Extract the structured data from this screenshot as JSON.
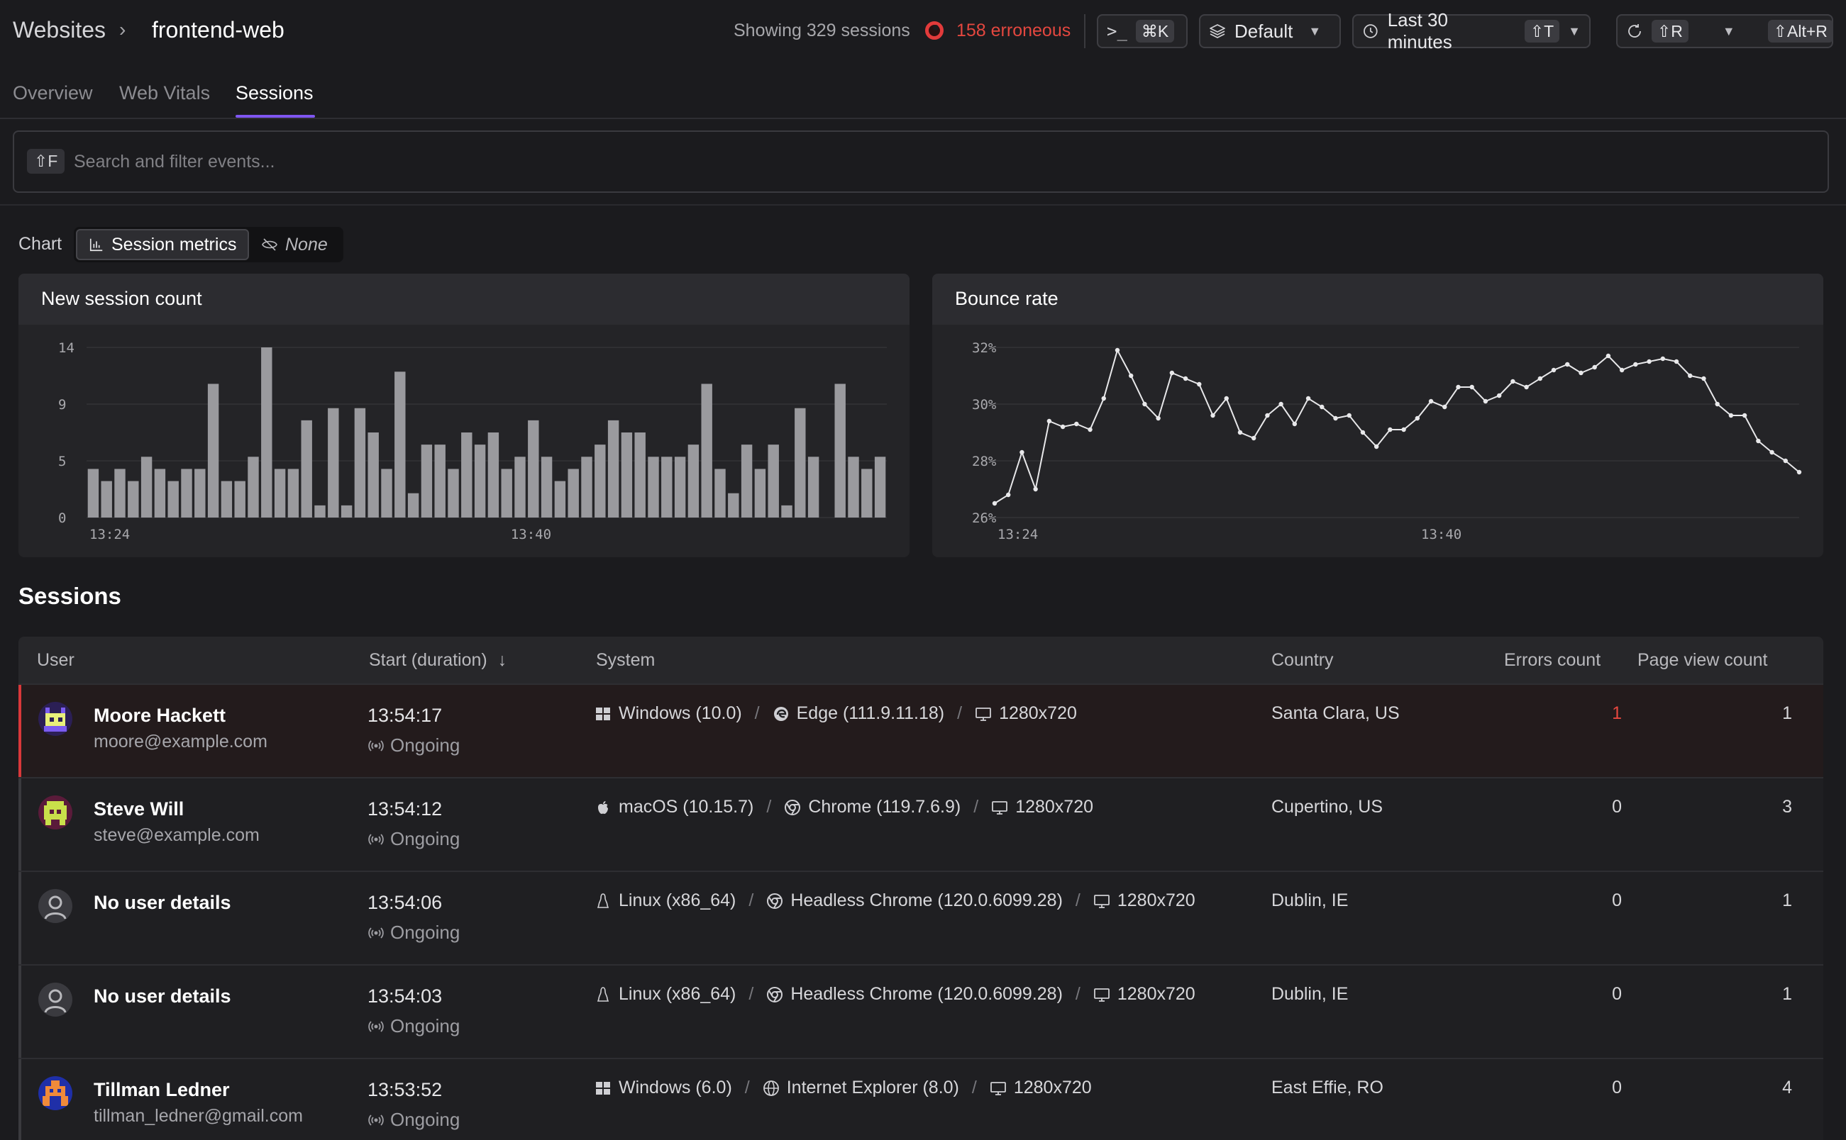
{
  "header": {
    "breadcrumb_root": "Websites",
    "breadcrumb_sep": "›",
    "breadcrumb_current": "frontend-web",
    "sessions_text": "Showing 329 sessions",
    "erroneous_text": "158 erroneous",
    "cmd_kbd": "⌘K",
    "env_label": "Default",
    "time_label": "Last 30 minutes",
    "time_kbd": "⇧T",
    "refresh_kbd": "⇧R",
    "auto_kbd": "⇧Alt+R"
  },
  "tabs": [
    {
      "label": "Overview",
      "active": false
    },
    {
      "label": "Web Vitals",
      "active": false
    },
    {
      "label": "Sessions",
      "active": true
    }
  ],
  "search": {
    "kbd": "⇧F",
    "placeholder": "Search and filter events..."
  },
  "chart_toggle": {
    "label": "Chart",
    "options": [
      "Session metrics",
      "None"
    ],
    "selected": "Session metrics"
  },
  "chart_data": [
    {
      "type": "bar",
      "title": "New session count",
      "ylim": [
        0,
        14
      ],
      "yticks": [
        "0",
        "5",
        "9",
        "14"
      ],
      "xticks": [
        "13:24",
        "13:40"
      ],
      "grid": true,
      "values": [
        4,
        3,
        4,
        3,
        5,
        4,
        3,
        4,
        4,
        11,
        3,
        3,
        5,
        14,
        4,
        4,
        8,
        1,
        9,
        1,
        9,
        7,
        4,
        12,
        2,
        6,
        6,
        4,
        7,
        6,
        7,
        4,
        5,
        8,
        5,
        3,
        4,
        5,
        6,
        8,
        7,
        7,
        5,
        5,
        5,
        6,
        11,
        4,
        2,
        6,
        4,
        6,
        1,
        9,
        5,
        0,
        11,
        5,
        4,
        5
      ]
    },
    {
      "type": "line",
      "title": "Bounce rate",
      "ylim": [
        26,
        32
      ],
      "yticks": [
        "26%",
        "28%",
        "30%",
        "32%"
      ],
      "xticks": [
        "13:24",
        "13:40"
      ],
      "grid": true,
      "values": [
        26.5,
        26.8,
        28.3,
        27.0,
        29.4,
        29.2,
        29.3,
        29.1,
        30.2,
        31.9,
        31.0,
        30.0,
        29.5,
        31.1,
        30.9,
        30.7,
        29.6,
        30.2,
        29.0,
        28.8,
        29.6,
        30.0,
        29.3,
        30.2,
        29.9,
        29.5,
        29.6,
        29.0,
        28.5,
        29.1,
        29.1,
        29.5,
        30.1,
        29.9,
        30.6,
        30.6,
        30.1,
        30.3,
        30.8,
        30.6,
        30.9,
        31.2,
        31.4,
        31.1,
        31.3,
        31.7,
        31.2,
        31.4,
        31.5,
        31.6,
        31.5,
        31.0,
        30.9,
        30.0,
        29.6,
        29.6,
        28.7,
        28.3,
        28.0,
        27.6
      ]
    }
  ],
  "sessions": {
    "title": "Sessions",
    "columns": [
      "User",
      "Start (duration)",
      "System",
      "Country",
      "Errors count",
      "Page view count"
    ],
    "rows": [
      {
        "name": "Moore Hackett",
        "email": "moore@example.com",
        "avatar": "avatar-purple",
        "start": "13:54:17",
        "duration": "Ongoing",
        "os_icon": "windows-icon",
        "os": "Windows (10.0)",
        "browser_icon": "edge-icon",
        "browser": "Edge (111.9.11.18)",
        "screen": "1280x720",
        "country": "Santa Clara, US",
        "errors": "1",
        "page_views": "1",
        "erroneous": true
      },
      {
        "name": "Steve Will",
        "email": "steve@example.com",
        "avatar": "avatar-green",
        "start": "13:54:12",
        "duration": "Ongoing",
        "os_icon": "apple-icon",
        "os": "macOS (10.15.7)",
        "browser_icon": "chrome-icon",
        "browser": "Chrome (119.7.6.9)",
        "screen": "1280x720",
        "country": "Cupertino, US",
        "errors": "0",
        "page_views": "3",
        "erroneous": false
      },
      {
        "name": "No user details",
        "email": "",
        "avatar": "avatar-default",
        "start": "13:54:06",
        "duration": "Ongoing",
        "os_icon": "linux-icon",
        "os": "Linux (x86_64)",
        "browser_icon": "chrome-icon",
        "browser": "Headless Chrome (120.0.6099.28)",
        "screen": "1280x720",
        "country": "Dublin, IE",
        "errors": "0",
        "page_views": "1",
        "erroneous": false
      },
      {
        "name": "No user details",
        "email": "",
        "avatar": "avatar-default",
        "start": "13:54:03",
        "duration": "Ongoing",
        "os_icon": "linux-icon",
        "os": "Linux (x86_64)",
        "browser_icon": "chrome-icon",
        "browser": "Headless Chrome (120.0.6099.28)",
        "screen": "1280x720",
        "country": "Dublin, IE",
        "errors": "0",
        "page_views": "1",
        "erroneous": false
      },
      {
        "name": "Tillman Ledner",
        "email": "tillman_ledner@gmail.com",
        "avatar": "avatar-blue",
        "start": "13:53:52",
        "duration": "Ongoing",
        "os_icon": "windows-icon",
        "os": "Windows (6.0)",
        "browser_icon": "globe-icon",
        "browser": "Internet Explorer (8.0)",
        "screen": "1280x720",
        "country": "East Effie, RO",
        "errors": "0",
        "page_views": "4",
        "erroneous": false
      }
    ]
  },
  "colors": {
    "accent": "#7f56f0",
    "error": "#e4473f",
    "bar": "#9a9a9e"
  }
}
